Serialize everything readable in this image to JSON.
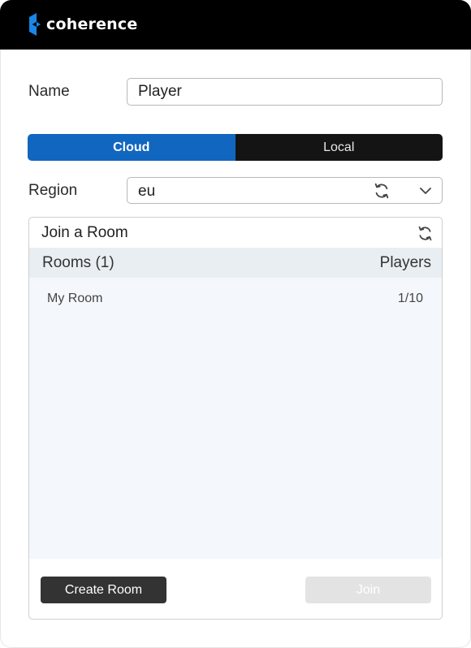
{
  "header": {
    "brand": "coherence",
    "background": "#000000",
    "logo_icon": "coherence-logo-icon"
  },
  "form": {
    "name_label": "Name",
    "name_value": "Player",
    "region_label": "Region",
    "region_value": "eu",
    "region_refresh_icon": "refresh-icon",
    "region_dropdown_icon": "chevron-down-icon"
  },
  "mode_toggle": {
    "cloud_label": "Cloud",
    "local_label": "Local",
    "selected": "Cloud",
    "active_color": "#1166c0",
    "inactive_color": "#141414"
  },
  "rooms_panel": {
    "title": "Join a Room",
    "refresh_icon": "refresh-icon",
    "columns": {
      "rooms": "Rooms (1)",
      "players": "Players"
    },
    "rows": [
      {
        "room": "My Room",
        "players": "1/10"
      }
    ],
    "create_button": "Create Room",
    "join_button": "Join"
  }
}
